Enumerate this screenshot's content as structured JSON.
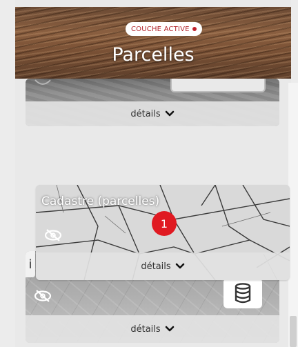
{
  "header": {
    "badge_label": "COUCHE ACTIVE",
    "title": "Parcelles",
    "badge_dot_color": "#c0202a"
  },
  "layers": [
    {
      "details_label": "détails",
      "icons": [
        "eye-slash-icon",
        "chevron-down-icon"
      ]
    },
    {
      "title": "Cadastre (parcelles)",
      "count": "1",
      "details_label": "détails",
      "icons": [
        "eye-slash-icon",
        "chevron-down-icon"
      ]
    },
    {
      "details_label": "détails",
      "info_label": "i",
      "icons": [
        "eye-slash-icon",
        "database-icon",
        "chevron-down-icon"
      ]
    }
  ]
}
